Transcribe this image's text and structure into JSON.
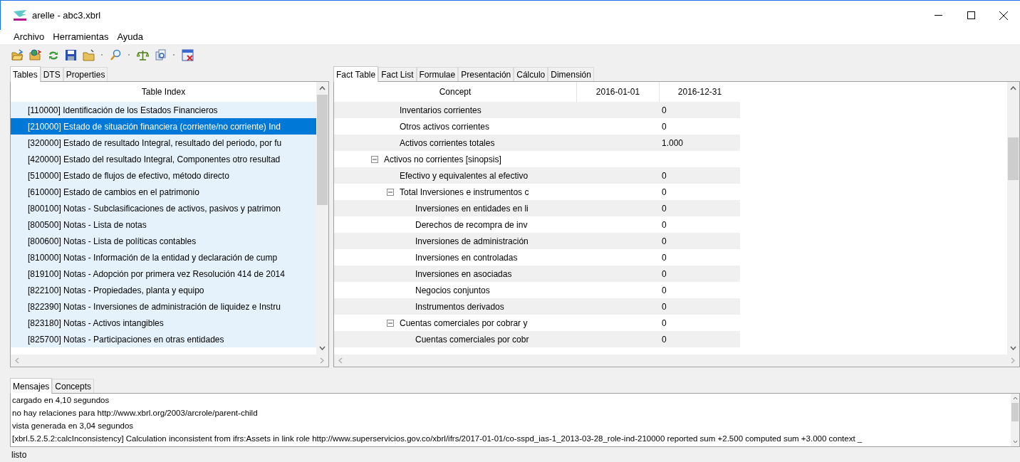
{
  "window": {
    "title": "arelle - abc3.xbrl"
  },
  "menu": [
    "Archivo",
    "Herramientas",
    "Ayuda"
  ],
  "toolbar": [
    {
      "kind": "open"
    },
    {
      "kind": "open-web"
    },
    {
      "kind": "reload"
    },
    {
      "kind": "save"
    },
    {
      "kind": "folder"
    },
    {
      "kind": "sep"
    },
    {
      "kind": "search"
    },
    {
      "kind": "sep"
    },
    {
      "kind": "validate"
    },
    {
      "kind": "compare"
    },
    {
      "kind": "sep"
    },
    {
      "kind": "close"
    }
  ],
  "left_tabs": [
    {
      "label": "Tables",
      "selected": true
    },
    {
      "label": "DTS",
      "selected": false
    },
    {
      "label": "Properties",
      "selected": false
    }
  ],
  "table_index": {
    "header": "Table Index",
    "items": [
      {
        "label": "[110000] Identificación de los Estados Financieros",
        "selected": false
      },
      {
        "label": "[210000] Estado de situación financiera (corriente/no corriente) Ind",
        "selected": true
      },
      {
        "label": "[320000] Estado de resultado Integral, resultado del periodo, por fu",
        "selected": false
      },
      {
        "label": "[420000] Estado del resultado Integral, Componentes otro resultad",
        "selected": false
      },
      {
        "label": "[510000] Estado de flujos de efectivo, método directo",
        "selected": false
      },
      {
        "label": "[610000] Estado de cambios en el patrimonio",
        "selected": false
      },
      {
        "label": "[800100] Notas - Subclasificaciones de activos, pasivos y patrimon",
        "selected": false
      },
      {
        "label": "[800500] Notas - Lista de notas",
        "selected": false
      },
      {
        "label": "[800600] Notas - Lista de políticas contables",
        "selected": false
      },
      {
        "label": "[810000] Notas - Información de la entidad y declaración de cump",
        "selected": false
      },
      {
        "label": "[819100] Notas - Adopción por primera vez Resolución 414 de 2014",
        "selected": false
      },
      {
        "label": "[822100] Notas - Propiedades, planta y equipo",
        "selected": false
      },
      {
        "label": "[822390] Notas - Inversiones de administración de liquidez e Instru",
        "selected": false
      },
      {
        "label": "[823180] Notas - Activos intangibles",
        "selected": false
      },
      {
        "label": "[825700] Notas - Participaciones en otras entidades",
        "selected": false
      }
    ]
  },
  "right_tabs": [
    {
      "label": "Fact Table",
      "selected": true
    },
    {
      "label": "Fact List",
      "selected": false
    },
    {
      "label": "Formulae",
      "selected": false
    },
    {
      "label": "Presentación",
      "selected": false
    },
    {
      "label": "Cálculo",
      "selected": false
    },
    {
      "label": "Dimensión",
      "selected": false
    }
  ],
  "fact_table": {
    "columns": [
      "Concept",
      "2016-01-01",
      "2016-12-31"
    ],
    "rows": [
      {
        "children": [
          {
            "concept": "Inventarios corrientes",
            "value": "0"
          },
          {
            "concept": "Otros activos corrientes",
            "value": "0"
          },
          {
            "concept": "Activos corrientes totales",
            "value": "1.000"
          }
        ]
      },
      {
        "concept": "Activos no corrientes [sinopsis]",
        "expanded": true,
        "children": [
          {
            "concept": "Efectivo y equivalentes al efectivo",
            "value": "0"
          },
          {
            "concept": "Total Inversiones e instrumentos c",
            "value": "0",
            "expanded": true,
            "children": [
              {
                "concept": "Inversiones en entidades en li",
                "value": "0"
              },
              {
                "concept": "Derechos de recompra de inv",
                "value": "0"
              },
              {
                "concept": "Inversiones de administración",
                "value": "0"
              },
              {
                "concept": "Inversiones en controladas",
                "value": "0"
              },
              {
                "concept": "Inversiones en asociadas",
                "value": "0"
              },
              {
                "concept": "Negocios conjuntos",
                "value": "0"
              },
              {
                "concept": "Instrumentos derivados",
                "value": "0"
              }
            ]
          },
          {
            "concept": "Cuentas comerciales por cobrar y",
            "value": "0",
            "expanded": true,
            "children": [
              {
                "concept": "Cuentas comerciales por cobr",
                "value": "0"
              }
            ]
          }
        ]
      }
    ]
  },
  "bottom_tabs": [
    {
      "label": "Mensajes",
      "selected": true
    },
    {
      "label": "Concepts",
      "selected": false
    }
  ],
  "messages": [
    "cargado en 4,10 segundos",
    "no hay relaciones para http://www.xbrl.org/2003/arcrole/parent-child",
    "vista generada en 3,04 segundos",
    "[xbrl.5.2.5.2:calcInconsistency] Calculation inconsistent from ifrs:Assets in link role http://www.superservicios.gov.co/xbrl/ifrs/2017-01-01/co-sspd_ias-1_2013-03-28_role-ind-210000 reported sum +2.500 computed sum +3.000 context _"
  ],
  "status_bar": "listo"
}
